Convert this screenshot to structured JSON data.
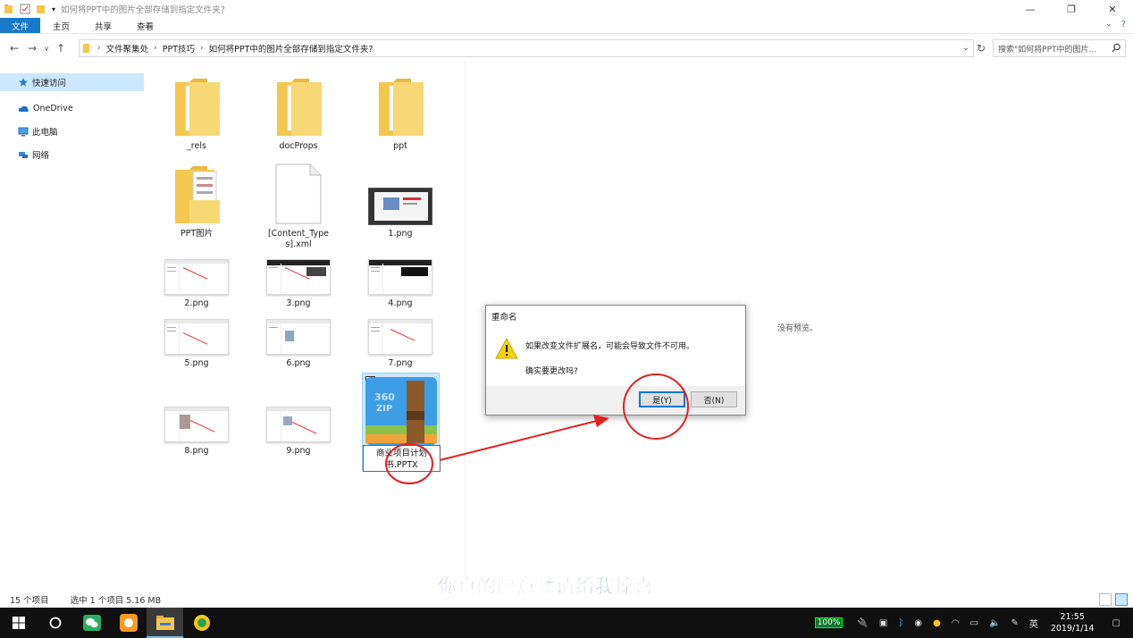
{
  "window": {
    "title": "如何将PPT中的图片全部存储到指定文件夹?",
    "minimize": "—",
    "maximize": "❐",
    "close": "✕"
  },
  "ribbon": {
    "tabs": [
      "文件",
      "主页",
      "共享",
      "查看"
    ]
  },
  "address": {
    "crumbs": [
      "文件聚集处",
      "PPT技巧",
      "如何将PPT中的图片全部存储到指定文件夹?"
    ],
    "search_placeholder": "搜索\"如何将PPT中的图片..."
  },
  "sidebar": {
    "items": [
      "快速访问",
      "OneDrive",
      "此电脑",
      "网络"
    ]
  },
  "files": [
    {
      "name": "_rels",
      "type": "folder"
    },
    {
      "name": "docProps",
      "type": "folder"
    },
    {
      "name": "ppt",
      "type": "folder"
    },
    {
      "name": "PPT图片",
      "type": "folder"
    },
    {
      "name": "[Content_Types].xml",
      "type": "file"
    },
    {
      "name": "1.png",
      "type": "image"
    },
    {
      "name": "2.png",
      "type": "image"
    },
    {
      "name": "3.png",
      "type": "image"
    },
    {
      "name": "4.png",
      "type": "image"
    },
    {
      "name": "5.png",
      "type": "image"
    },
    {
      "name": "6.png",
      "type": "image"
    },
    {
      "name": "7.png",
      "type": "image"
    },
    {
      "name": "8.png",
      "type": "image"
    },
    {
      "name": "9.png",
      "type": "image"
    },
    {
      "name": "商业项目计划书.PPTX",
      "type": "archive",
      "line1": "商业项目计划",
      "line2": "书.PPTX",
      "badge": "360 ZIP"
    }
  ],
  "preview": {
    "text": "没有预览。"
  },
  "dialog": {
    "title": "重命名",
    "message": "如果改变文件扩展名，可能会导致文件不可用。",
    "question": "确实要更改吗?",
    "yes": "是(Y)",
    "no": "否(N)"
  },
  "status": {
    "count": "15 个项目",
    "selected": "选中 1 个项目  5.16 MB"
  },
  "subtitle": "你真的愿意就请给我惊喜",
  "taskbar": {
    "battery": "100%",
    "lang": "英",
    "time": "21:55",
    "date": "2019/1/14"
  },
  "colors": {
    "accent": "#1979ca",
    "selection": "#cce8ff",
    "annotation": "#e32020",
    "folder": "#f8d775"
  }
}
